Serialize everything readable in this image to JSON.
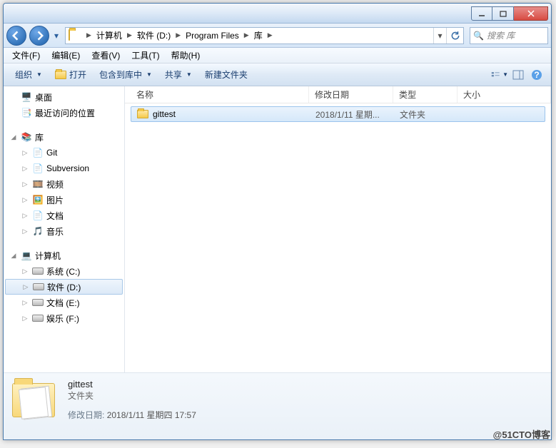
{
  "titlebar": {},
  "nav": {
    "breadcrumb": [
      "计算机",
      "软件 (D:)",
      "Program Files",
      "库"
    ],
    "search_placeholder": "搜索 库"
  },
  "menubar": [
    "文件(F)",
    "编辑(E)",
    "查看(V)",
    "工具(T)",
    "帮助(H)"
  ],
  "toolbar": {
    "organize": "组织",
    "open": "打开",
    "include": "包含到库中",
    "share": "共享",
    "newfolder": "新建文件夹"
  },
  "sidebar": {
    "favorites": [
      {
        "label": "桌面",
        "icon": "desktop"
      },
      {
        "label": "最近访问的位置",
        "icon": "recent"
      }
    ],
    "libraries_label": "库",
    "libraries": [
      {
        "label": "Git",
        "icon": "git"
      },
      {
        "label": "Subversion",
        "icon": "svn"
      },
      {
        "label": "视频",
        "icon": "video"
      },
      {
        "label": "图片",
        "icon": "picture"
      },
      {
        "label": "文档",
        "icon": "doc"
      },
      {
        "label": "音乐",
        "icon": "music"
      }
    ],
    "computer_label": "计算机",
    "drives": [
      {
        "label": "系统 (C:)",
        "selected": false
      },
      {
        "label": "软件 (D:)",
        "selected": true
      },
      {
        "label": "文档 (E:)",
        "selected": false
      },
      {
        "label": "娱乐 (F:)",
        "selected": false
      }
    ]
  },
  "columns": {
    "name": "名称",
    "date": "修改日期",
    "type": "类型",
    "size": "大小"
  },
  "files": [
    {
      "name": "gittest",
      "date": "2018/1/11 星期...",
      "type": "文件夹",
      "selected": true
    }
  ],
  "details": {
    "name": "gittest",
    "type": "文件夹",
    "date_label": "修改日期:",
    "date_value": "2018/1/11 星期四 17:57"
  },
  "watermark": "@51CTO博客"
}
